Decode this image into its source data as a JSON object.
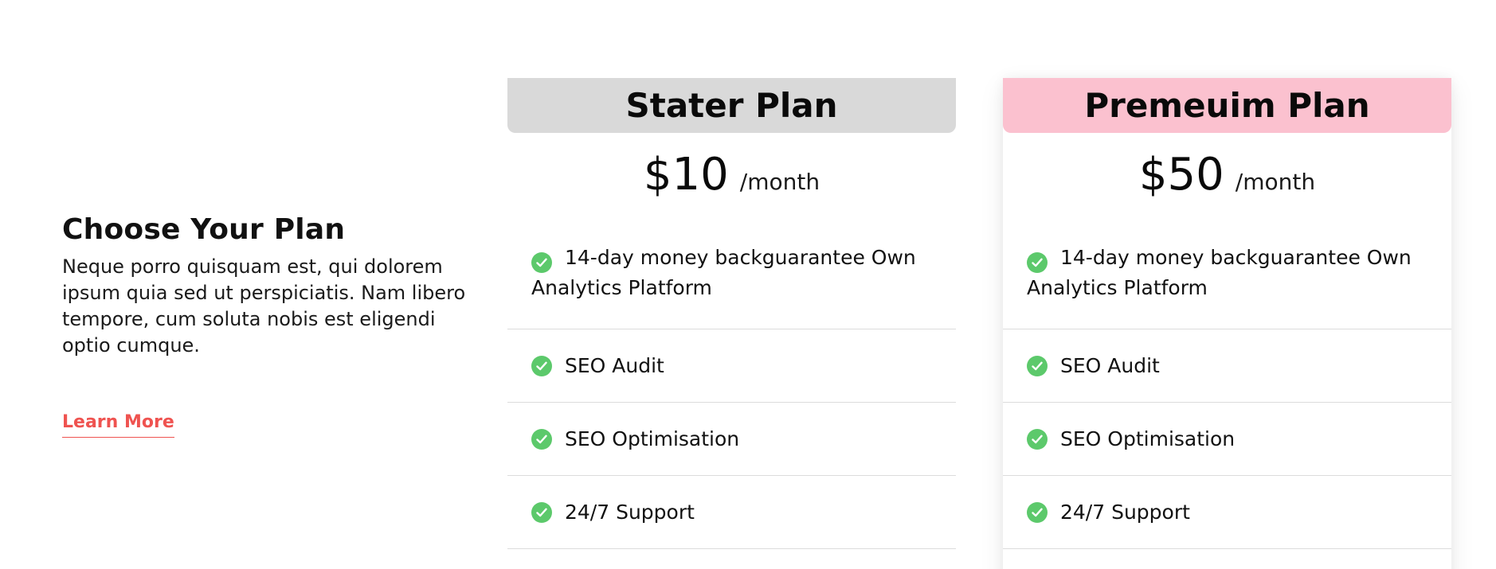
{
  "intro": {
    "title": "Choose Your Plan",
    "description": "Neque porro quisquam est, qui dolorem ipsum quia sed ut perspiciatis. Nam libero tempore, cum soluta nobis est eligendi optio cumque.",
    "learn_more_label": "Learn More",
    "accent_color": "#ef5350"
  },
  "plans": [
    {
      "name": "Stater Plan",
      "header_color": "#d9d9d9",
      "price": "$10",
      "period": "/month",
      "features": [
        "14-day money backguarantee Own Analytics Platform",
        "SEO Audit",
        "SEO Optimisation",
        "24/7 Support"
      ]
    },
    {
      "name": "Premeuim Plan",
      "header_color": "#fbc1cf",
      "price": "$50",
      "period": "/month",
      "features": [
        "14-day money backguarantee Own Analytics Platform",
        "SEO Audit",
        "SEO Optimisation",
        "24/7 Support"
      ]
    }
  ],
  "icons": {
    "feature_check": "check-circle-icon",
    "check_color": "#5cc96b"
  }
}
